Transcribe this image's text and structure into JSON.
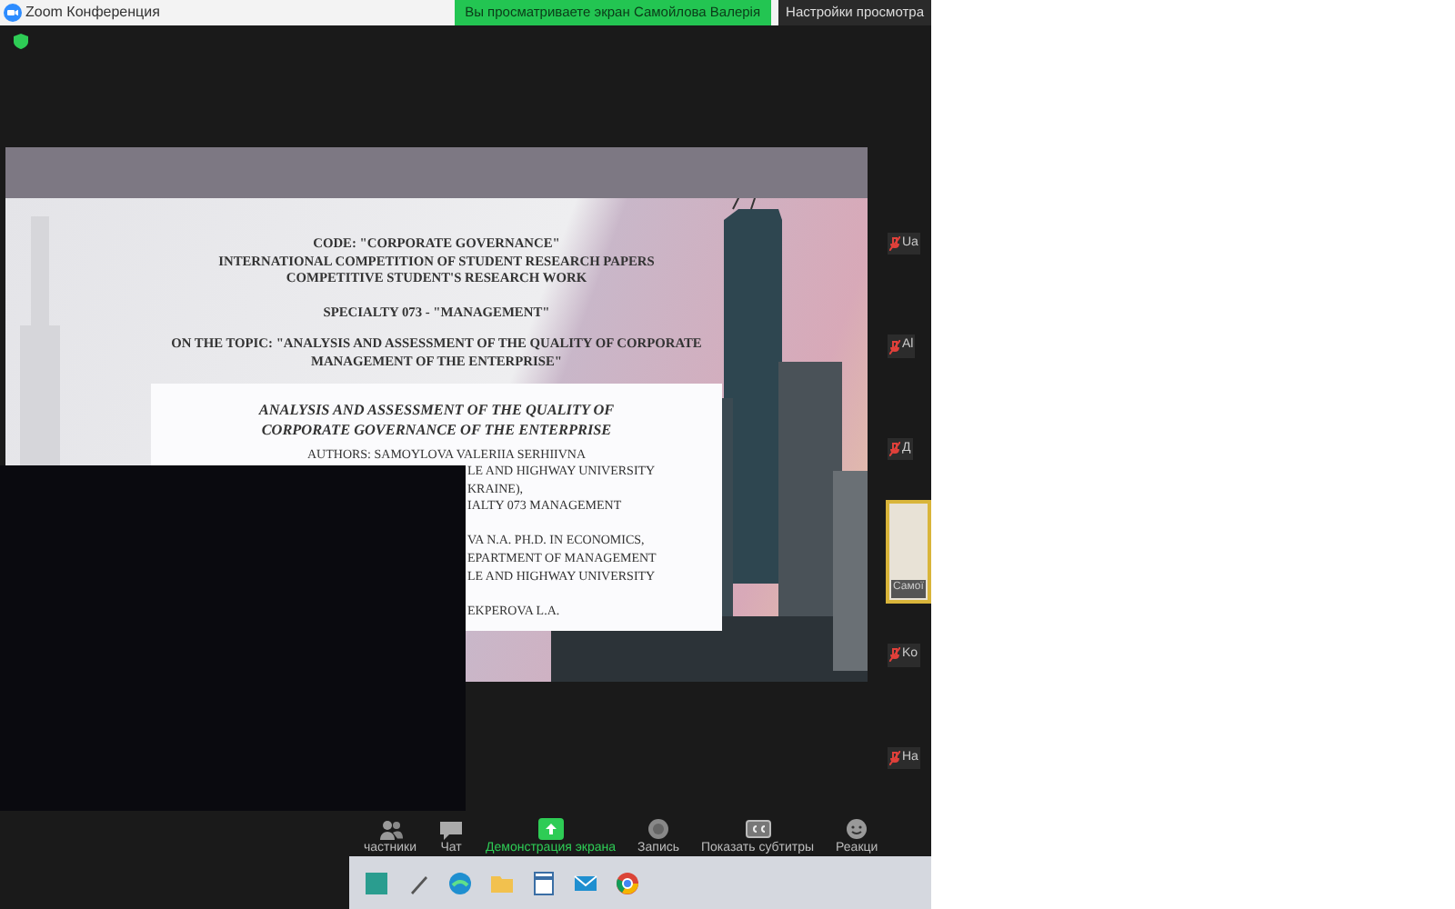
{
  "window": {
    "title": "Zoom Конференция"
  },
  "share_banner": {
    "text": "Вы просматриваете экран Самойлова Валерія"
  },
  "view_options": {
    "label": "Настройки просмотра"
  },
  "slide": {
    "header_lines": [
      "CODE: \"CORPORATE GOVERNANCE\"",
      "INTERNATIONAL COMPETITION OF STUDENT RESEARCH PAPERS",
      "COMPETITIVE STUDENT'S RESEARCH WORK"
    ],
    "specialty": "SPECIALTY 073 - \"MANAGEMENT\"",
    "topic": "ON THE TOPIC: \"ANALYSIS AND ASSESSMENT OF THE QUALITY OF CORPORATE MANAGEMENT OF THE ENTERPRISE\"",
    "box_title": "ANALYSIS AND ASSESSMENT OF THE QUALITY OF CORPORATE GOVERNANCE OF THE ENTERPRISE",
    "authors": "AUTHORS: SAMOYLOVA VALERIIA SERHIIVNA",
    "box_groups": [
      [
        "LE AND HIGHWAY UNIVERSITY",
        "KRAINE),",
        "IALTY 073 MANAGEMENT"
      ],
      [
        "VA N.A. PH.D. IN ECONOMICS,",
        "EPARTMENT OF MANAGEMENT",
        "LE AND HIGHWAY UNIVERSITY"
      ],
      [
        "EKPEROVA L.A."
      ]
    ]
  },
  "participants": [
    {
      "name": "Ua",
      "muted": true,
      "speaking": false
    },
    {
      "name": "Al",
      "muted": true,
      "speaking": false
    },
    {
      "name": "Д",
      "muted": true,
      "speaking": false
    },
    {
      "name": "Самої",
      "muted": false,
      "speaking": true
    },
    {
      "name": "Ko",
      "muted": true,
      "speaking": false
    },
    {
      "name": "Ha",
      "muted": true,
      "speaking": false
    }
  ],
  "toolbar": [
    {
      "label": "частники",
      "kind": "participants",
      "selected": false
    },
    {
      "label": "Чат",
      "kind": "chat",
      "selected": false
    },
    {
      "label": "Демонстрация экрана",
      "kind": "share",
      "selected": true
    },
    {
      "label": "Запись",
      "kind": "record",
      "selected": false
    },
    {
      "label": "Показать субтитры",
      "kind": "captions",
      "selected": false
    },
    {
      "label": "Реакци",
      "kind": "reactions",
      "selected": false
    }
  ]
}
